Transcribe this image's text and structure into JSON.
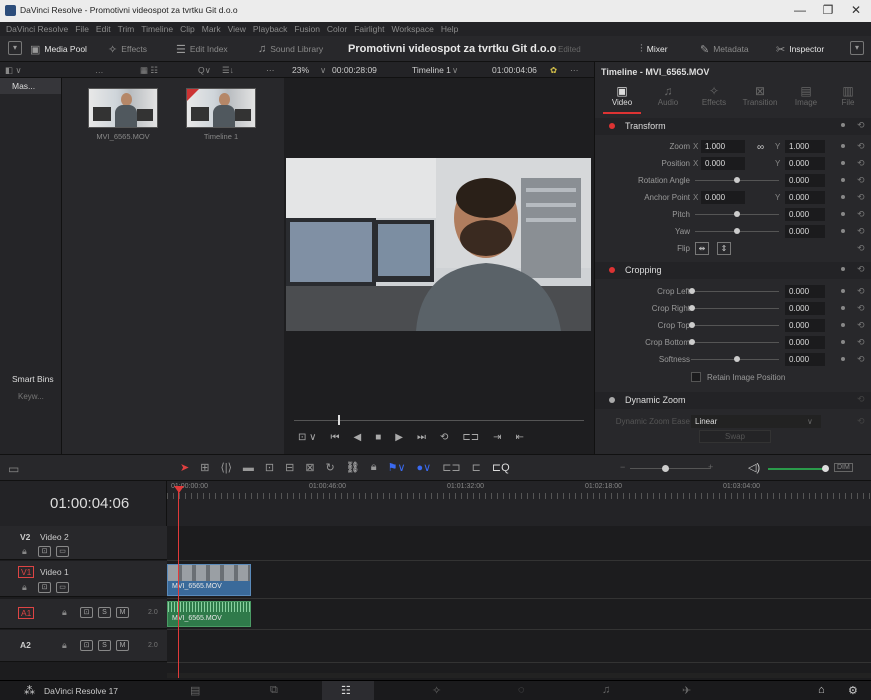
{
  "titlebar": {
    "title": "DaVinci Resolve - Promotivni videospot za tvrtku Git d.o.o",
    "minimize": "—",
    "maximize": "❐",
    "close": "✕"
  },
  "menu": [
    "DaVinci Resolve",
    "File",
    "Edit",
    "Trim",
    "Timeline",
    "Clip",
    "Mark",
    "View",
    "Playback",
    "Fusion",
    "Color",
    "Fairlight",
    "Workspace",
    "Help"
  ],
  "toolbar": {
    "media_pool": "Media Pool",
    "effects": "Effects",
    "edit_index": "Edit Index",
    "sound_library": "Sound Library",
    "project_title": "Promotivni videospot za tvrtku Git d.o.o",
    "edited": "Edited",
    "mixer": "Mixer",
    "metadata": "Metadata",
    "inspector": "Inspector"
  },
  "subbar": {
    "zoom": "23%",
    "timecode": "00:00:28:09",
    "timeline": "Timeline 1",
    "viewer_tc": "01:00:04:06"
  },
  "leftcol": {
    "master": "Mas...",
    "smart_bins": "Smart Bins",
    "keywords": "Keyw..."
  },
  "mediapool": {
    "clips": [
      {
        "name": "MVI_6565.MOV"
      },
      {
        "name": "Timeline 1"
      }
    ]
  },
  "inspector": {
    "title": "Timeline - MVI_6565.MOV",
    "tabs": [
      "Video",
      "Audio",
      "Effects",
      "Transition",
      "Image",
      "File"
    ],
    "transform": {
      "label": "Transform",
      "zoom_x": "1.000",
      "zoom_y": "1.000",
      "pos_x": "0.000",
      "pos_y": "0.000",
      "rotation": "0.000",
      "anchor_x": "0.000",
      "anchor_y": "0.000",
      "pitch": "0.000",
      "yaw": "0.000"
    },
    "labels": {
      "zoom": "Zoom",
      "position": "Position",
      "rotation": "Rotation Angle",
      "anchor": "Anchor Point",
      "pitch": "Pitch",
      "yaw": "Yaw",
      "flip": "Flip",
      "x": "X",
      "y": "Y"
    },
    "cropping": {
      "label": "Cropping",
      "crop_left": "0.000",
      "crop_right": "0.000",
      "crop_top": "0.000",
      "crop_bottom": "0.000",
      "softness": "0.000",
      "retain": "Retain Image Position"
    },
    "crop_labels": {
      "left": "Crop Left",
      "right": "Crop Right",
      "top": "Crop Top",
      "bottom": "Crop Bottom",
      "softness": "Softness"
    },
    "dynamic_zoom": {
      "label": "Dynamic Zoom",
      "ease_label": "Dynamic Zoom Ease",
      "ease_value": "Linear",
      "swap": "Swap"
    }
  },
  "timeline": {
    "timecode": "01:00:04:06",
    "ruler": [
      "01:00:00:00",
      "01:00:46:00",
      "01:01:32:00",
      "01:02:18:00",
      "01:03:04:00"
    ],
    "tracks": [
      {
        "id": "V2",
        "name": "Video 2"
      },
      {
        "id": "V1",
        "name": "Video 1",
        "clip": "MVI_6565.MOV"
      },
      {
        "id": "A1",
        "ch": "2.0",
        "clip": "MVI_6565.MOV"
      },
      {
        "id": "A2",
        "ch": "2.0"
      }
    ],
    "dim": "DIM",
    "s": "S",
    "m": "M"
  },
  "bottombar": {
    "app": "DaVinci Resolve 17"
  },
  "colors": {
    "accent_red": "#d33333",
    "clip_blue": "#3a6a9a",
    "clip_green": "#2f7a4a",
    "playhead": "#e03a3a"
  }
}
